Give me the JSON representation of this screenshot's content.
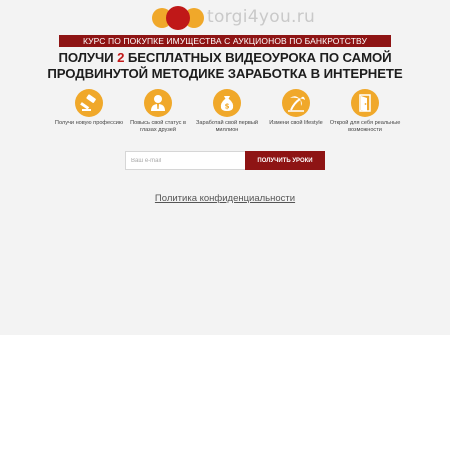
{
  "logo": {
    "text": "torgi4you.ru",
    "icon": "three-circles-logo",
    "colors": [
      "#f0a82a",
      "#c01818",
      "#f0a82a"
    ]
  },
  "banner": {
    "text": "КУРС ПО ПОКУПКЕ ИМУЩЕСТВА С АУКЦИОНОВ ПО БАНКРОТСТВУ"
  },
  "headline": {
    "part1": "ПОЛУЧИ ",
    "highlight": "2",
    "part2": " БЕСПЛАТНЫХ ВИДЕОУРОКА ПО САМОЙ ПРОДВИНУТОЙ МЕТОДИКЕ ЗАРАБОТКА В ИНТЕРНЕТЕ"
  },
  "features": [
    {
      "icon": "gavel-icon",
      "label": "Получи новую профессию"
    },
    {
      "icon": "businessman-icon",
      "label": "Повысь свой статус в глазах друзей"
    },
    {
      "icon": "money-bag-icon",
      "label": "Заработай свой первый миллион"
    },
    {
      "icon": "palm-tree-icon",
      "label": "Измени свой lifestyle"
    },
    {
      "icon": "door-icon",
      "label": "Открой для себя реальные возможности"
    }
  ],
  "form": {
    "email_placeholder": "Ваш e-mail",
    "email_value": "",
    "submit_label": "ПОЛУЧИТЬ УРОКИ"
  },
  "footer": {
    "policy_link": "Политика конфиденциальности"
  },
  "colors": {
    "accent_red": "#8e1414",
    "highlight_red": "#c01818",
    "icon_orange": "#f0a82a",
    "background": "#f3f3f3"
  }
}
